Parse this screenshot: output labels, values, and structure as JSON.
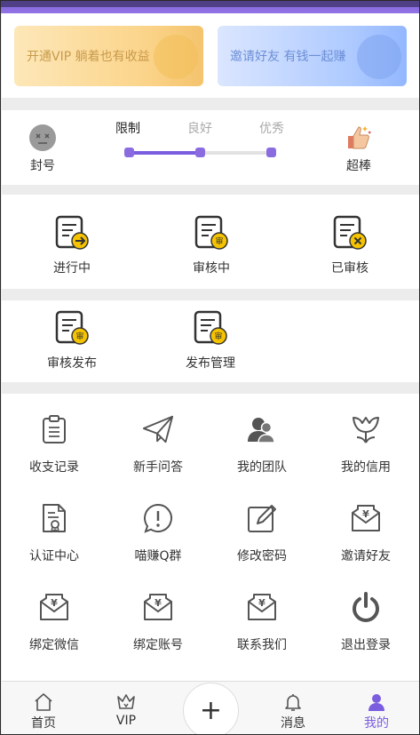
{
  "banners": {
    "vip": "开通VIP 躺着也有收益",
    "invite": "邀请好友 有钱一起赚"
  },
  "level": {
    "left_label": "封号",
    "right_label": "超棒",
    "tabs": [
      "限制",
      "良好",
      "优秀"
    ],
    "progress": 0.5,
    "colors": {
      "accent": "#7b5de0"
    }
  },
  "tasks_row1": [
    {
      "label": "进行中",
      "icon": "doc-arrow-icon"
    },
    {
      "label": "审核中",
      "icon": "doc-review-icon"
    },
    {
      "label": "已审核",
      "icon": "doc-x-icon"
    }
  ],
  "tasks_row2": [
    {
      "label": "审核发布",
      "icon": "doc-review-icon"
    },
    {
      "label": "发布管理",
      "icon": "doc-review-icon"
    }
  ],
  "grid": [
    {
      "label": "收支记录",
      "icon": "clipboard-icon"
    },
    {
      "label": "新手问答",
      "icon": "paper-plane-icon"
    },
    {
      "label": "我的团队",
      "icon": "team-icon"
    },
    {
      "label": "我的信用",
      "icon": "tulip-icon"
    },
    {
      "label": "认证中心",
      "icon": "certificate-icon"
    },
    {
      "label": "喵赚Q群",
      "icon": "alert-bubble-icon"
    },
    {
      "label": "修改密码",
      "icon": "edit-icon"
    },
    {
      "label": "邀请好友",
      "icon": "yen-envelope-icon"
    },
    {
      "label": "绑定微信",
      "icon": "yen-envelope-icon"
    },
    {
      "label": "绑定账号",
      "icon": "yen-envelope-icon"
    },
    {
      "label": "联系我们",
      "icon": "yen-envelope-icon"
    },
    {
      "label": "退出登录",
      "icon": "power-icon"
    }
  ],
  "tabbar": {
    "home": "首页",
    "vip": "VIP",
    "plus": "+",
    "messages": "消息",
    "mine": "我的",
    "active": "mine"
  }
}
